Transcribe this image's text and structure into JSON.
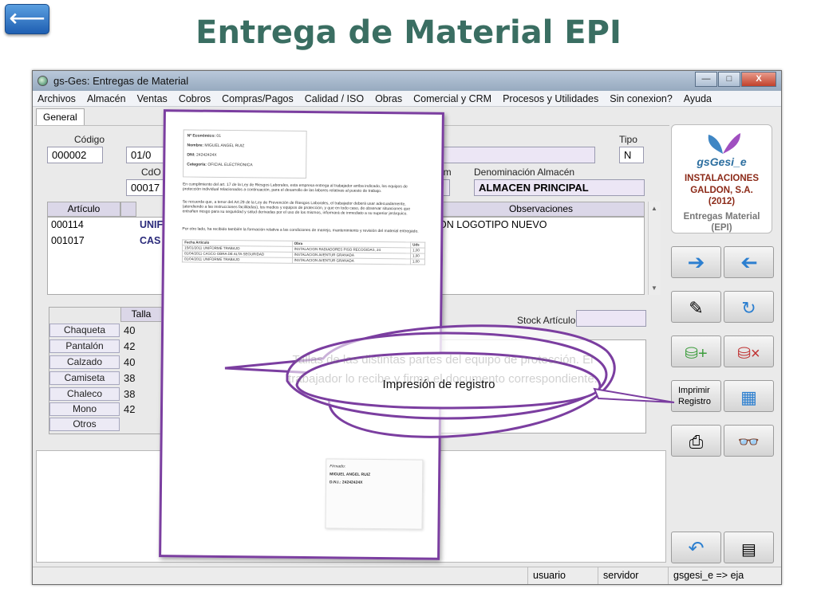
{
  "slide": {
    "title": "Entrega de Material EPI",
    "back_icon": "⟵"
  },
  "window": {
    "title": "gs-Ges: Entregas de Material",
    "controls": {
      "minimize": "—",
      "maximize": "□",
      "close": "X"
    }
  },
  "menu": [
    "Archivos",
    "Almacén",
    "Ventas",
    "Cobros",
    "Compras/Pagos",
    "Calidad / ISO",
    "Obras",
    "Comercial y CRM",
    "Procesos y Utilidades",
    "Sin conexion?",
    "Ayuda"
  ],
  "tab": "General",
  "form": {
    "codigo_label": "Código",
    "codigo_value": "000002",
    "fecha_value": "01/0",
    "cdo_label": "CdO",
    "cdo_value": "00017",
    "alm_label_partial": "lm",
    "tipo_label": "Tipo",
    "tipo_value": "N",
    "almacen_label": "Denominación Almacén",
    "almacen_value": "ALMACEN PRINCIPAL"
  },
  "grid": {
    "headers": {
      "articulo": "Artículo",
      "observaciones": "Observaciones"
    },
    "rows": [
      {
        "articulo": "000114",
        "desc": "UNIF",
        "obs": "ON LOGOTIPO NUEVO"
      },
      {
        "articulo": "001017",
        "desc": "CAS",
        "obs": ""
      }
    ]
  },
  "tallas": {
    "header": "Talla",
    "items": [
      {
        "label": "Chaqueta",
        "value": "40"
      },
      {
        "label": "Pantalón",
        "value": "42"
      },
      {
        "label": "Calzado",
        "value": "40"
      },
      {
        "label": "Camiseta",
        "value": "38"
      },
      {
        "label": "Chaleco",
        "value": "38"
      },
      {
        "label": "Mono",
        "value": "42"
      },
      {
        "label": "Otros",
        "value": ""
      }
    ]
  },
  "stock_label": "Stock Artículo",
  "logo": {
    "brand": "gsGesi_e",
    "company_line1": "INSTALACIONES",
    "company_line2": "GALDON, S.A.",
    "company_line3": "(2012)",
    "module_line1": "Entregas Material",
    "module_line2": "(EPI)"
  },
  "buttons": {
    "print_record_line1": "Imprimir",
    "print_record_line2": "Registro"
  },
  "statusbar": {
    "user": "usuario",
    "server": "servidor",
    "app": "gsgesi_e => eja"
  },
  "document": {
    "meta": [
      {
        "k": "Nº Económico:",
        "v": "01"
      },
      {
        "k": "Nombre:",
        "v": "MIGUEL ANGEL RUIZ"
      },
      {
        "k": "DNI:",
        "v": "24242424X"
      },
      {
        "k": "Categoría:",
        "v": "OFICIAL ELECTRONICA"
      }
    ],
    "para1": "En cumplimiento del art. 17 de la Ley de Riesgos Laborales, esta empresa entrega al trabajador arriba indicado, los equipos de protección individual relacionados a continuación, para el desarrollo de las labores relativas al puesto de trabajo.",
    "para2": "Se recuerda que, a tenor del Art.29 de la Ley de Prevención de Riesgos Laborales, el trabajador deberá usar adecuadamente, (atendiendo a las instrucciones facilitadas), los medios y equipos de protección, y que en todo caso, de observar situaciones que entrañen riesgo para su seguridad y salud derivadas por el uso de los mismos, informará de inmediato a su superior jerárquico.",
    "para3": "Por otro lado, ha recibido también la formación relativa a las condiciones de manejo, mantenimiento y revisión del material entregado.",
    "table_headers": {
      "fecha": "Fecha",
      "articulo": "Artículo",
      "obra": "Obra",
      "uds": "Uds"
    },
    "table_rows": [
      {
        "fecha": "15/01/2011",
        "articulo": "UNIFORME TRABAJO",
        "obra": "INSTALACION RADIADORES PISO RECOGIDAS, 24",
        "uds": "1,00"
      },
      {
        "fecha": "01/04/2011",
        "articulo": "CASCO OBRA DE ALTA SEGURIDAD",
        "obra": "INSTALACION AVENTUR GRANADA",
        "uds": "1,00"
      },
      {
        "fecha": "01/04/2011",
        "articulo": "UNIFORME TRABAJO",
        "obra": "INSTALACION AVENTUR GRANADA",
        "uds": "1,00"
      }
    ],
    "signed_label": "Firmado:",
    "signed_name": "MIGUEL ANGEL RUIZ",
    "signed_dni": "D.N.I.: 24242424X"
  },
  "callouts": {
    "faded": "Tallas de las distintas partes del equipo de protección. El trabajador lo recibe y firma el documento correspondiente.",
    "main": "Impresión de registro"
  },
  "colors": {
    "title": "#3a6e62",
    "document_border": "#7b3ea0",
    "callout_border": "#7b3ea0"
  }
}
